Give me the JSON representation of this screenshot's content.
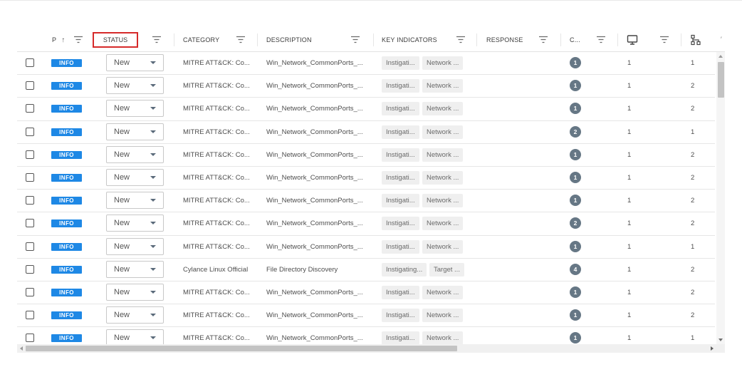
{
  "columns": {
    "priority": "P",
    "sort_arrow": "↑",
    "status": "STATUS",
    "category": "CATEGORY",
    "description": "DESCRIPTION",
    "key_indicators": "KEY INDICATORS",
    "response": "RESPONSE",
    "count": "C..."
  },
  "icons": {
    "filter": "filter-icon",
    "monitor": "monitor-icon",
    "tree": "network-tree-icon",
    "dropdown": "chevron-down-icon"
  },
  "colors": {
    "badge": "#1e88e5",
    "count_circle": "#667785",
    "highlight_border": "#d62a2a"
  },
  "rows": [
    {
      "priority": "INFO",
      "status": "New",
      "category": "MITRE ATT&CK: Co...",
      "description": "Win_Network_CommonPorts_...",
      "ind1": "Instigati...",
      "ind2": "Network ...",
      "count": "1",
      "col_monitor": "1",
      "col_tree": "1"
    },
    {
      "priority": "INFO",
      "status": "New",
      "category": "MITRE ATT&CK: Co...",
      "description": "Win_Network_CommonPorts_...",
      "ind1": "Instigati...",
      "ind2": "Network ...",
      "count": "1",
      "col_monitor": "1",
      "col_tree": "2"
    },
    {
      "priority": "INFO",
      "status": "New",
      "category": "MITRE ATT&CK: Co...",
      "description": "Win_Network_CommonPorts_...",
      "ind1": "Instigati...",
      "ind2": "Network ...",
      "count": "1",
      "col_monitor": "1",
      "col_tree": "2"
    },
    {
      "priority": "INFO",
      "status": "New",
      "category": "MITRE ATT&CK: Co...",
      "description": "Win_Network_CommonPorts_...",
      "ind1": "Instigati...",
      "ind2": "Network ...",
      "count": "2",
      "col_monitor": "1",
      "col_tree": "1"
    },
    {
      "priority": "INFO",
      "status": "New",
      "category": "MITRE ATT&CK: Co...",
      "description": "Win_Network_CommonPorts_...",
      "ind1": "Instigati...",
      "ind2": "Network ...",
      "count": "1",
      "col_monitor": "1",
      "col_tree": "2"
    },
    {
      "priority": "INFO",
      "status": "New",
      "category": "MITRE ATT&CK: Co...",
      "description": "Win_Network_CommonPorts_...",
      "ind1": "Instigati...",
      "ind2": "Network ...",
      "count": "1",
      "col_monitor": "1",
      "col_tree": "2"
    },
    {
      "priority": "INFO",
      "status": "New",
      "category": "MITRE ATT&CK: Co...",
      "description": "Win_Network_CommonPorts_...",
      "ind1": "Instigati...",
      "ind2": "Network ...",
      "count": "1",
      "col_monitor": "1",
      "col_tree": "2"
    },
    {
      "priority": "INFO",
      "status": "New",
      "category": "MITRE ATT&CK: Co...",
      "description": "Win_Network_CommonPorts_...",
      "ind1": "Instigati...",
      "ind2": "Network ...",
      "count": "2",
      "col_monitor": "1",
      "col_tree": "2"
    },
    {
      "priority": "INFO",
      "status": "New",
      "category": "MITRE ATT&CK: Co...",
      "description": "Win_Network_CommonPorts_...",
      "ind1": "Instigati...",
      "ind2": "Network ...",
      "count": "1",
      "col_monitor": "1",
      "col_tree": "1"
    },
    {
      "priority": "INFO",
      "status": "New",
      "category": "Cylance Linux Official",
      "description": "File Directory Discovery",
      "ind1": "Instigating...",
      "ind2": "Target ...",
      "count": "4",
      "col_monitor": "1",
      "col_tree": "2"
    },
    {
      "priority": "INFO",
      "status": "New",
      "category": "MITRE ATT&CK: Co...",
      "description": "Win_Network_CommonPorts_...",
      "ind1": "Instigati...",
      "ind2": "Network ...",
      "count": "1",
      "col_monitor": "1",
      "col_tree": "2"
    },
    {
      "priority": "INFO",
      "status": "New",
      "category": "MITRE ATT&CK: Co...",
      "description": "Win_Network_CommonPorts_...",
      "ind1": "Instigati...",
      "ind2": "Network ...",
      "count": "1",
      "col_monitor": "1",
      "col_tree": "2"
    },
    {
      "priority": "INFO",
      "status": "New",
      "category": "MITRE ATT&CK: Co...",
      "description": "Win_Network_CommonPorts_...",
      "ind1": "Instigati...",
      "ind2": "Network ...",
      "count": "1",
      "col_monitor": "1",
      "col_tree": "1"
    }
  ]
}
